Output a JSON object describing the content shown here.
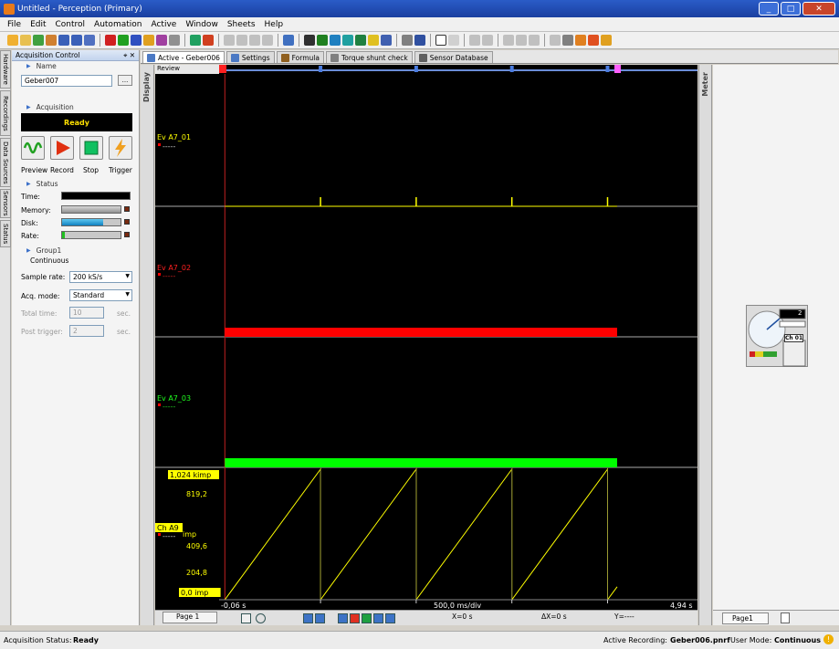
{
  "window": {
    "title": "Untitled - Perception (Primary)",
    "min": "_",
    "max": "□",
    "close": "✕"
  },
  "menu": [
    "File",
    "Edit",
    "Control",
    "Automation",
    "Active",
    "Window",
    "Sheets",
    "Help"
  ],
  "left_tabs": [
    "Hardware",
    "Recordings",
    "Data Sources",
    "Sensors",
    "Status"
  ],
  "acq": {
    "header": "Acquisition Control",
    "pin": "⌖ ✕",
    "name_section": "Name",
    "name_value": "Geber007",
    "browse": "...",
    "acq_section": "Acquisition",
    "state": "Ready",
    "buttons": [
      "Preview",
      "Record",
      "Stop",
      "Trigger"
    ],
    "status_section": "Status",
    "status_rows": [
      "Time:",
      "Memory:",
      "Disk:",
      "Rate:"
    ],
    "memory_level": 1.0,
    "disk_level": 0.7,
    "rate_level": 0.05,
    "group_section": "Group1",
    "continuous": "Continuous",
    "sample_rate_label": "Sample rate:",
    "sample_rate_value": "200 kS/s",
    "acq_mode_label": "Acq. mode:",
    "acq_mode_value": "Standard",
    "total_time_label": "Total time:",
    "total_time_value": "10",
    "total_time_unit": "sec.",
    "post_trigger_label": "Post trigger:",
    "post_trigger_value": "2",
    "post_trigger_unit": "sec."
  },
  "tabs": [
    "Active - Geber006",
    "Settings",
    "Formula",
    "Torque shunt check",
    "Sensor Database"
  ],
  "display_label": "Display",
  "meter_label": "Meter",
  "plot": {
    "review": "Review",
    "ch1": "Ev A7_01",
    "ch2": "Ev A7_02",
    "ch3": "Ev A7_03",
    "ch4": "Ch A9",
    "dash": "-----",
    "y_top": "1,024 kimp",
    "y_819": "819,2",
    "y_imp": "imp",
    "y_409": "409,6",
    "y_204": "204,8",
    "y_zero": "0,0  imp",
    "x_start": "-0,06 s",
    "x_div": "500,0 ms/div",
    "x_end": "4,94 s",
    "colors": {
      "ch1": "#ffff00",
      "ch2": "#ff0000",
      "ch3": "#00ff00",
      "ch4": "#ffff00",
      "red_label": "#ff2020",
      "green_label": "#20ff20",
      "yellow_label": "#ffff00"
    }
  },
  "chart_data": {
    "type": "line",
    "series": [
      {
        "name": "Ch A9",
        "x": [
          0.0,
          1.0,
          1.0,
          2.0,
          2.0,
          3.0,
          3.0,
          4.0,
          4.0,
          4.1
        ],
        "values": [
          0,
          1024,
          0,
          1024,
          0,
          1024,
          0,
          1024,
          0,
          102
        ]
      }
    ],
    "xlim": [
      -0.06,
      4.94
    ],
    "ylim": [
      0,
      1024
    ]
  },
  "bottom": {
    "page": "Page 1",
    "x": "X=0 s",
    "dx": "ΔX=0 s",
    "y": "Y=----"
  },
  "meter": {
    "page": "Page1",
    "display_value": "2",
    "ch_label": "Ch 01"
  },
  "statusbar": {
    "acq_status_label": "Acquisition Status:",
    "acq_status_value": "Ready",
    "active_recording_label": "Active Recording:",
    "active_recording_value": "Geber006.pnrf",
    "user_mode_label": "User Mode:",
    "user_mode_value": "Continuous"
  }
}
